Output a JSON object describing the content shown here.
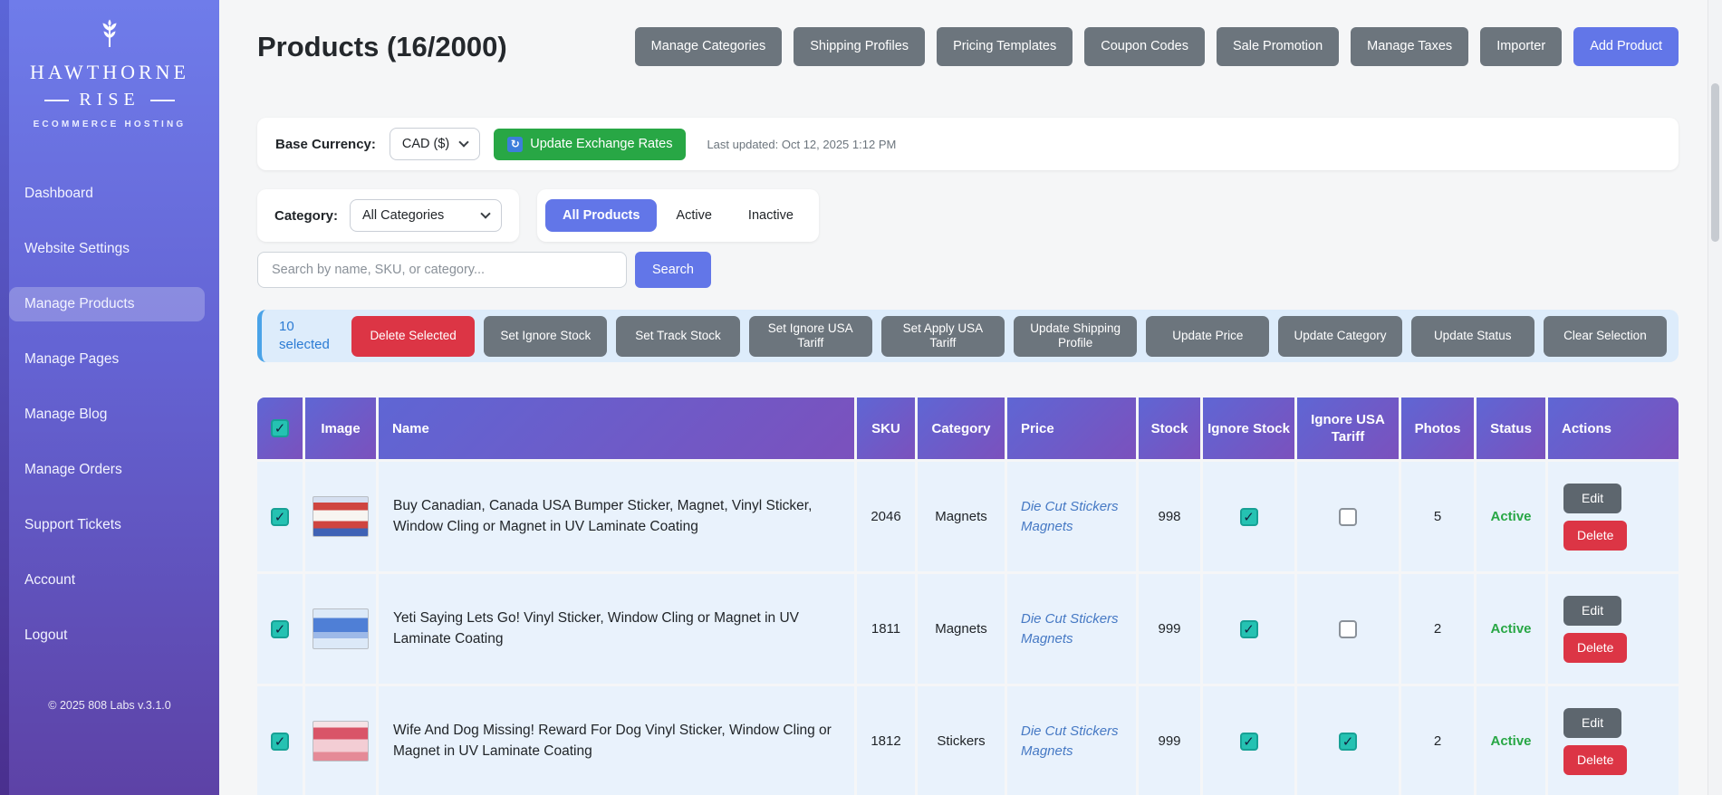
{
  "colors": {
    "accent_blue": "#6276e8",
    "secondary_gray": "#6c757d",
    "success_green": "#28a745",
    "danger_red": "#dc3545",
    "checkbox_teal": "#25c2b2",
    "price_link_blue": "#4679c4",
    "status_active_green": "#28a745",
    "bulk_bar_bg": "#ddecfb",
    "selected_row_bg": "#e9f2fc",
    "table_header_gradient": [
      "#5f66d4",
      "#7b51bd"
    ],
    "sidebar_gradient": [
      "#6f7cea",
      "#5d42a6"
    ]
  },
  "sidebar": {
    "logo_title_top": "HAWTHORNE",
    "logo_title_bottom": "RISE",
    "logo_subtitle": "ECOMMERCE HOSTING",
    "items": [
      {
        "label": "Dashboard",
        "active": false
      },
      {
        "label": "Website Settings",
        "active": false
      },
      {
        "label": "Manage Products",
        "active": true
      },
      {
        "label": "Manage Pages",
        "active": false
      },
      {
        "label": "Manage Blog",
        "active": false
      },
      {
        "label": "Manage Orders",
        "active": false
      },
      {
        "label": "Support Tickets",
        "active": false
      },
      {
        "label": "Account",
        "active": false
      },
      {
        "label": "Logout",
        "active": false
      }
    ],
    "footer": "© 2025 808 Labs v.3.1.0"
  },
  "header": {
    "title": "Products (16/2000)",
    "buttons": [
      {
        "label": "Manage Categories",
        "variant": "secondary"
      },
      {
        "label": "Shipping Profiles",
        "variant": "secondary"
      },
      {
        "label": "Pricing Templates",
        "variant": "secondary"
      },
      {
        "label": "Coupon Codes",
        "variant": "secondary"
      },
      {
        "label": "Sale Promotion",
        "variant": "secondary"
      },
      {
        "label": "Manage Taxes",
        "variant": "secondary"
      },
      {
        "label": "Importer",
        "variant": "secondary"
      },
      {
        "label": "Add Product",
        "variant": "primary"
      }
    ]
  },
  "currency_bar": {
    "label": "Base Currency:",
    "selected_currency": "CAD ($)",
    "update_button_label": "Update Exchange Rates",
    "last_updated": "Last updated: Oct 12, 2025 1:12 PM"
  },
  "filters": {
    "category_label": "Category:",
    "category_selected": "All Categories",
    "tabs": [
      {
        "label": "All Products",
        "active": true
      },
      {
        "label": "Active",
        "active": false
      },
      {
        "label": "Inactive",
        "active": false
      }
    ]
  },
  "search": {
    "placeholder": "Search by name, SKU, or category...",
    "button_label": "Search"
  },
  "bulk_actions": {
    "selected_count": "10 selected",
    "buttons": [
      {
        "label": "Delete Selected",
        "variant": "danger"
      },
      {
        "label": "Set Ignore Stock",
        "variant": "secondary"
      },
      {
        "label": "Set Track Stock",
        "variant": "secondary"
      },
      {
        "label": "Set Ignore USA Tariff",
        "variant": "secondary"
      },
      {
        "label": "Set Apply USA Tariff",
        "variant": "secondary"
      },
      {
        "label": "Update Shipping Profile",
        "variant": "secondary"
      },
      {
        "label": "Update Price",
        "variant": "secondary"
      },
      {
        "label": "Update Category",
        "variant": "secondary"
      },
      {
        "label": "Update Status",
        "variant": "secondary"
      },
      {
        "label": "Clear Selection",
        "variant": "secondary"
      }
    ]
  },
  "table": {
    "header_checkbox_checked": true,
    "columns": [
      "",
      "Image",
      "Name",
      "SKU",
      "Category",
      "Price",
      "Stock",
      "Ignore Stock",
      "Ignore USA Tariff",
      "Photos",
      "Status",
      "Actions"
    ],
    "rows": [
      {
        "selected": true,
        "thumb": "canada",
        "name": "Buy Canadian, Canada USA Bumper Sticker, Magnet, Vinyl Sticker, Window Cling or Magnet in UV Laminate Coating",
        "sku": "2046",
        "category": "Magnets",
        "price_links": "Die Cut Stickers Magnets",
        "stock": "998",
        "ignore_stock": true,
        "ignore_usa_tariff": false,
        "photos": "5",
        "status": "Active",
        "edit_label": "Edit",
        "delete_label": "Delete"
      },
      {
        "selected": true,
        "thumb": "letsgo",
        "name": "Yeti Saying Lets Go! Vinyl Sticker, Window Cling or Magnet in UV Laminate Coating",
        "sku": "1811",
        "category": "Magnets",
        "price_links": "Die Cut Stickers Magnets",
        "stock": "999",
        "ignore_stock": true,
        "ignore_usa_tariff": false,
        "photos": "2",
        "status": "Active",
        "edit_label": "Edit",
        "delete_label": "Delete"
      },
      {
        "selected": true,
        "thumb": "dog",
        "name": "Wife And Dog Missing! Reward For Dog Vinyl Sticker, Window Cling or Magnet in UV Laminate Coating",
        "sku": "1812",
        "category": "Stickers",
        "price_links": "Die Cut Stickers Magnets",
        "stock": "999",
        "ignore_stock": true,
        "ignore_usa_tariff": true,
        "photos": "2",
        "status": "Active",
        "edit_label": "Edit",
        "delete_label": "Delete"
      }
    ]
  }
}
